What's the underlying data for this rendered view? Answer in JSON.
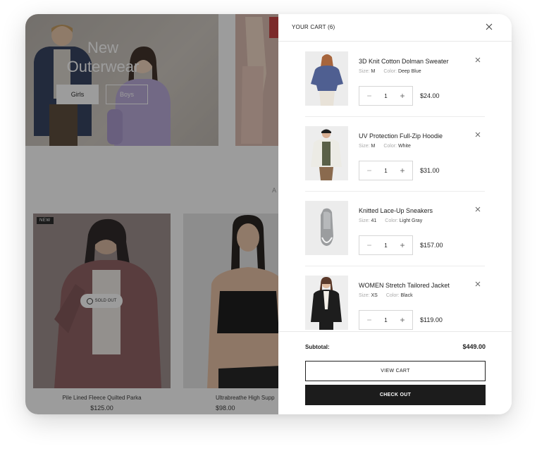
{
  "store": {
    "banner": {
      "title": "New Outerwear",
      "buttons": [
        "Girls",
        "Boys"
      ]
    },
    "faint_letter": "A",
    "products": [
      {
        "name": "Pile Lined Fleece Quilted Parka",
        "price": "$125.00",
        "badge": "NEW",
        "status": "SOLD OUT"
      },
      {
        "name": "Ultrabreathe High Supp",
        "price": "$98.00"
      }
    ]
  },
  "cart": {
    "title": "YOUR CART (6)",
    "close_icon": "close-icon",
    "labels": {
      "size": "Size:",
      "color": "Color:"
    },
    "items": [
      {
        "name": "3D Knit Cotton Dolman Sweater",
        "size": "M",
        "color": "Deep Blue",
        "qty": "1",
        "price": "$24.00"
      },
      {
        "name": "UV Protection Full-Zip Hoodie",
        "size": "M",
        "color": "White",
        "qty": "1",
        "price": "$31.00"
      },
      {
        "name": "Knitted Lace-Up Sneakers",
        "size": "41",
        "color": "Light Gray",
        "qty": "1",
        "price": "$157.00"
      },
      {
        "name": "WOMEN Stretch Tailored Jacket",
        "size": "XS",
        "color": "Black",
        "qty": "1",
        "price": "$119.00"
      }
    ],
    "subtotal_label": "Subtotal:",
    "subtotal_value": "$449.00",
    "view_cart": "VIEW CART",
    "checkout": "CHECK OUT"
  },
  "colors": {
    "overlay": "#2b2b2b",
    "checkout_bg": "#1c1c1c",
    "divider": "#e8e8e8"
  }
}
